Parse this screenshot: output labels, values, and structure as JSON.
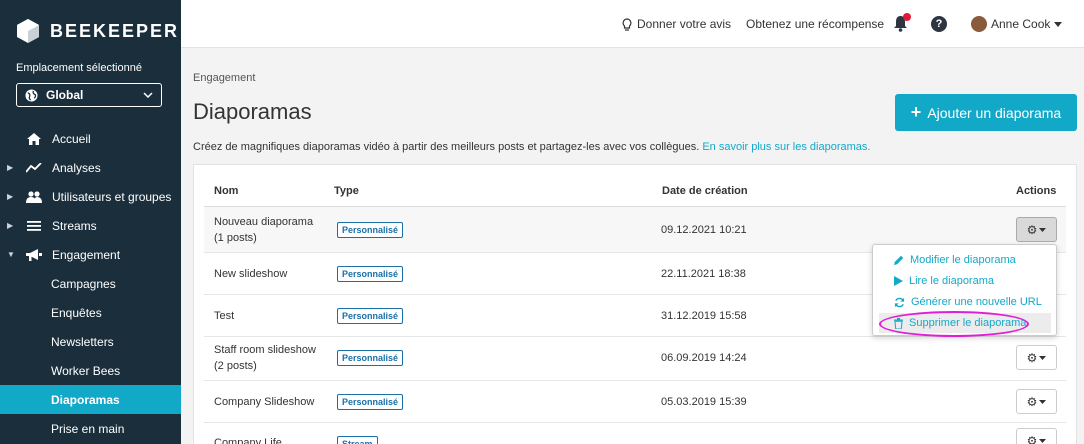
{
  "brand": {
    "name": "BEEKEEPER"
  },
  "location": {
    "label": "Emplacement sélectionné",
    "value": "Global"
  },
  "sidebar": {
    "items": [
      {
        "label": "Accueil",
        "icon": "home-icon"
      },
      {
        "label": "Analyses",
        "icon": "chart-line-icon"
      },
      {
        "label": "Utilisateurs et groupes",
        "icon": "users-icon"
      },
      {
        "label": "Streams",
        "icon": "list-icon"
      },
      {
        "label": "Engagement",
        "icon": "megaphone-icon"
      },
      {
        "label": "Campagnes"
      },
      {
        "label": "Enquêtes"
      },
      {
        "label": "Newsletters"
      },
      {
        "label": "Worker Bees"
      },
      {
        "label": "Diaporamas"
      },
      {
        "label": "Prise en main"
      }
    ]
  },
  "topbar": {
    "feedback": "Donner votre avis",
    "reward": "Obtenez une récompense",
    "help": "?",
    "user": "Anne Cook"
  },
  "main": {
    "breadcrumb": "Engagement",
    "title": "Diaporamas",
    "add_button": "Ajouter un diaporama",
    "description": "Créez de magnifiques diaporamas vidéo à partir des meilleurs posts et partagez-les avec vos collègues.",
    "learn_more": "En savoir plus sur les diaporamas."
  },
  "table": {
    "headers": {
      "name": "Nom",
      "type": "Type",
      "date": "Date de création",
      "actions": "Actions"
    },
    "rows": [
      {
        "name": "Nouveau diaporama",
        "sub": "(1 posts)",
        "type": "Personnalisé",
        "date": "09.12.2021 10:21"
      },
      {
        "name": "New slideshow",
        "sub": "",
        "type": "Personnalisé",
        "date": "22.11.2021 18:38"
      },
      {
        "name": "Test",
        "sub": "",
        "type": "Personnalisé",
        "date": "31.12.2019 15:58"
      },
      {
        "name": "Staff room slideshow",
        "sub": "(2 posts)",
        "type": "Personnalisé",
        "date": "06.09.2019 14:24"
      },
      {
        "name": "Company Slideshow",
        "sub": "",
        "type": "Personnalisé",
        "date": "05.03.2019 15:39"
      },
      {
        "name": "Company Life",
        "sub": "",
        "type": "Stream",
        "date": ""
      }
    ]
  },
  "dropdown": {
    "items": [
      {
        "label": "Modifier le diaporama",
        "icon": "pencil-icon"
      },
      {
        "label": "Lire le diaporama",
        "icon": "play-icon"
      },
      {
        "label": "Générer une nouvelle URL",
        "icon": "refresh-icon"
      },
      {
        "label": "Supprimer le diaporama",
        "icon": "trash-icon"
      }
    ]
  },
  "colors": {
    "accent": "#12a9c9",
    "sidebar": "#1a2e3b",
    "badge": "#1b6fa8",
    "annotation": "#e01ed6"
  }
}
